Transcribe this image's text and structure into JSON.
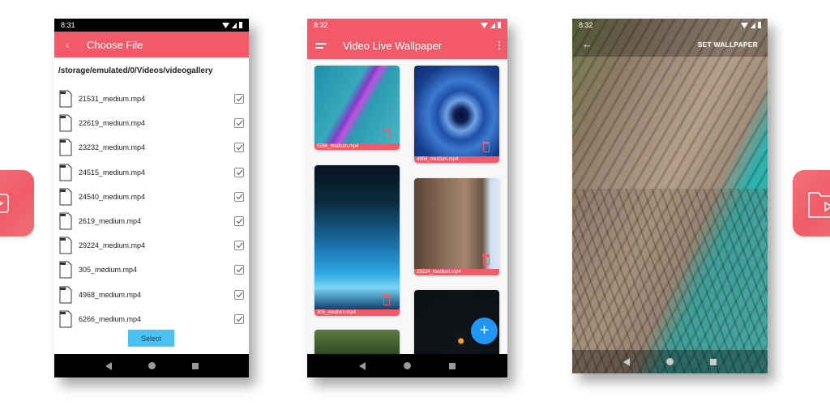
{
  "colors": {
    "primary": "#f25a69",
    "accent_blue": "#2196f3",
    "select_button": "#4ac3f3"
  },
  "screens": [
    {
      "name": "choose-file",
      "status_time": "8:31",
      "title": "Choose File",
      "back_icon": "chevron-left-icon",
      "path": "/storage/emulated/0/Videos/videogallery",
      "files": [
        {
          "name": "21531_medium.mp4",
          "checked": true
        },
        {
          "name": "22619_medium.mp4",
          "checked": true
        },
        {
          "name": "23232_medium.mp4",
          "checked": true
        },
        {
          "name": "24515_medium.mp4",
          "checked": true
        },
        {
          "name": "24540_medium.mp4",
          "checked": true
        },
        {
          "name": "2619_medium.mp4",
          "checked": true
        },
        {
          "name": "29224_medium.mp4",
          "checked": true
        },
        {
          "name": "305_medium.mp4",
          "checked": true
        },
        {
          "name": "4968_medium.mp4",
          "checked": true
        },
        {
          "name": "6266_medium.mp4",
          "checked": true
        }
      ],
      "select_label": "Select"
    },
    {
      "name": "video-live-wallpaper",
      "status_time": "8:32",
      "title": "Video Live Wallpaper",
      "cards": [
        {
          "label": "6266_medium.mp4"
        },
        {
          "label": "4968_medium.mp4"
        },
        {
          "label": "305_medium.mp4"
        },
        {
          "label": "29224_medium.mp4"
        },
        {
          "label": ""
        },
        {
          "label": ""
        }
      ],
      "fab_label": "+"
    },
    {
      "name": "set-wallpaper-preview",
      "status_time": "8:32",
      "action_label": "SET WALLPAPER",
      "back_icon": "arrow-left-icon"
    }
  ]
}
